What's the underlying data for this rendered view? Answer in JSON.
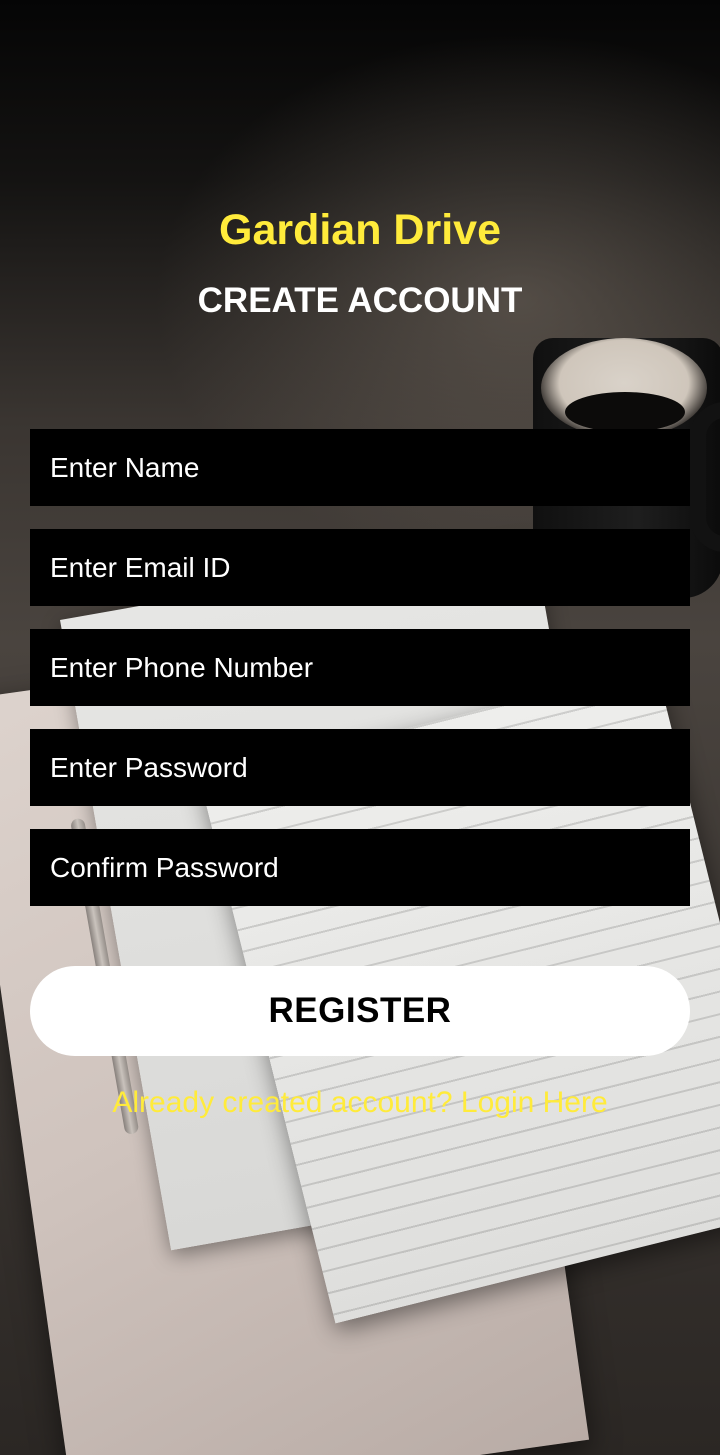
{
  "app": {
    "title": "Gardian Drive",
    "screen_title": "CREATE ACCOUNT"
  },
  "form": {
    "fields": [
      {
        "placeholder": "Enter Name",
        "value": ""
      },
      {
        "placeholder": "Enter Email ID",
        "value": ""
      },
      {
        "placeholder": "Enter Phone Number",
        "value": ""
      },
      {
        "placeholder": "Enter Password",
        "value": ""
      },
      {
        "placeholder": "Confirm Password",
        "value": ""
      }
    ],
    "register_label": "REGISTER",
    "login_link": "Already created account? Login Here"
  },
  "colors": {
    "accent": "#ffeb3b",
    "field_background": "#000000",
    "button_background": "#ffffff"
  }
}
